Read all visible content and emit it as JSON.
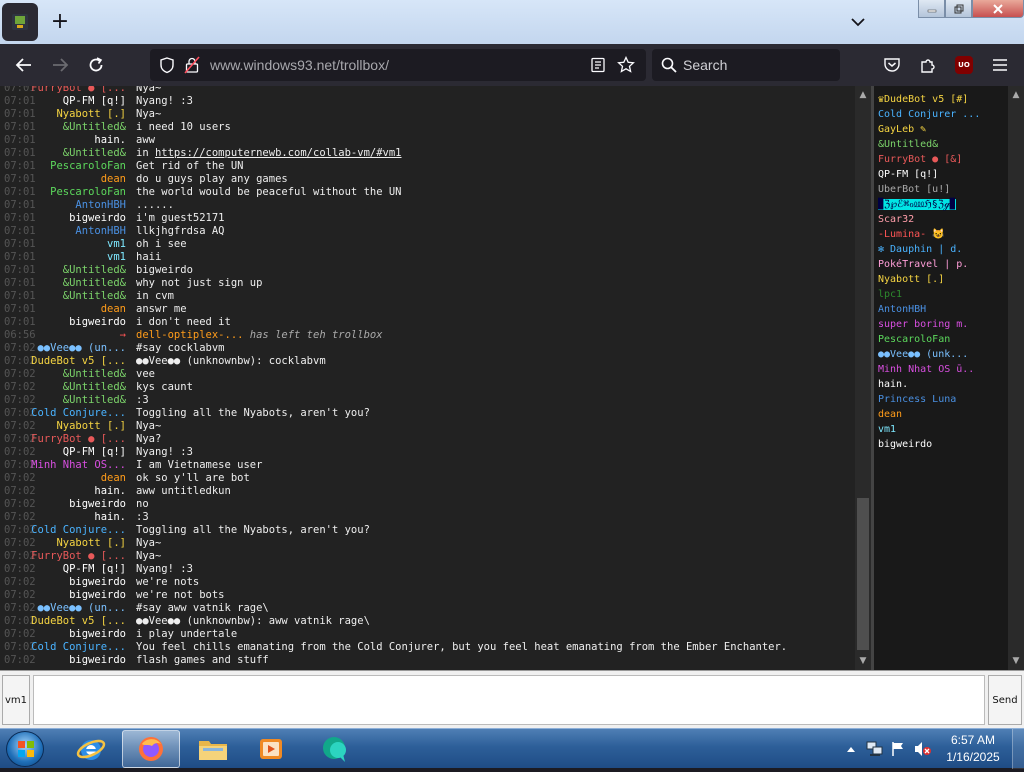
{
  "browser": {
    "url_host": "www.windows93.net",
    "url_path": "/trollbox/",
    "search_placeholder": "Search"
  },
  "trollbox": {
    "messages": [
      {
        "t": "07:01",
        "nick": "FurryBot ● [...",
        "nc": "#e85959",
        "msg": "Nya~"
      },
      {
        "t": "07:01",
        "nick": "QP-FM [q!]",
        "nc": "#ffffff",
        "msg": "Nyang! :3"
      },
      {
        "t": "07:01",
        "nick": "Nyabott [.]",
        "nc": "#f5d442",
        "msg": "Nya~"
      },
      {
        "t": "07:01",
        "nick": "&Untitled&",
        "nc": "#7bd36a",
        "msg": "i need 10 users"
      },
      {
        "t": "07:01",
        "nick": "hain.",
        "nc": "#ffffff",
        "msg": "aww"
      },
      {
        "t": "07:01",
        "nick": "&Untitled&",
        "nc": "#7bd36a",
        "msg": "in ",
        "link": "https://computernewb.com/collab-vm/#vm1"
      },
      {
        "t": "07:01",
        "nick": "PescaroloFan",
        "nc": "#5cd85c",
        "msg": "Get rid of the UN"
      },
      {
        "t": "07:01",
        "nick": "dean",
        "nc": "#ff9c1a",
        "msg": "do u guys play any games"
      },
      {
        "t": "07:01",
        "nick": "PescaroloFan",
        "nc": "#5cd85c",
        "msg": "the world would be peaceful without the UN"
      },
      {
        "t": "07:01",
        "nick": "AntonHBH",
        "nc": "#4a90e2",
        "msg": "......"
      },
      {
        "t": "07:01",
        "nick": "bigweirdo",
        "nc": "#ffffff",
        "msg": "i'm guest52171"
      },
      {
        "t": "07:01",
        "nick": "AntonHBH",
        "nc": "#4a90e2",
        "msg": "llkjhgfrdsa AQ"
      },
      {
        "t": "07:01",
        "nick": "vm1",
        "nc": "#7ee8ff",
        "msg": "oh i see"
      },
      {
        "t": "07:01",
        "nick": "vm1",
        "nc": "#7ee8ff",
        "msg": "haii"
      },
      {
        "t": "07:01",
        "nick": "&Untitled&",
        "nc": "#7bd36a",
        "msg": "bigweirdo"
      },
      {
        "t": "07:01",
        "nick": "&Untitled&",
        "nc": "#7bd36a",
        "msg": "why not just sign up"
      },
      {
        "t": "07:01",
        "nick": "&Untitled&",
        "nc": "#7bd36a",
        "msg": "in cvm"
      },
      {
        "t": "07:01",
        "nick": "dean",
        "nc": "#ff9c1a",
        "msg": "answr me"
      },
      {
        "t": "07:01",
        "nick": "bigweirdo",
        "nc": "#ffffff",
        "msg": "i don't need it"
      },
      {
        "t": "06:56",
        "nick": "→",
        "nc": "#ff5555",
        "sysnick": "dell-optiplex-...",
        "msg": " has left teh trollbox",
        "sys": true
      },
      {
        "t": "07:02",
        "nick": "●●Vee●● (un...",
        "nc": "#7ac0ff",
        "msg": "#say cocklabvm"
      },
      {
        "t": "07:02",
        "nick": "DudeBot v5 [...",
        "nc": "#f5d442",
        "msg": "●●Vee●● (unknownbw): cocklabvm"
      },
      {
        "t": "07:02",
        "nick": "&Untitled&",
        "nc": "#7bd36a",
        "msg": "vee"
      },
      {
        "t": "07:02",
        "nick": "&Untitled&",
        "nc": "#7bd36a",
        "msg": "kys caunt"
      },
      {
        "t": "07:02",
        "nick": "&Untitled&",
        "nc": "#7bd36a",
        "msg": ":3"
      },
      {
        "t": "07:02",
        "nick": "Cold Conjure...",
        "nc": "#4ab3ff",
        "msg": "Toggling all the Nyabots, aren't you?"
      },
      {
        "t": "07:02",
        "nick": "Nyabott [.]",
        "nc": "#f5d442",
        "msg": "Nya~"
      },
      {
        "t": "07:02",
        "nick": "FurryBot ● [...",
        "nc": "#e85959",
        "msg": "Nya?"
      },
      {
        "t": "07:02",
        "nick": "QP-FM [q!]",
        "nc": "#ffffff",
        "msg": "Nyang! :3"
      },
      {
        "t": "07:02",
        "nick": "Minh Nhat OS...",
        "nc": "#d84fe0",
        "msg": "I am Vietnamese user"
      },
      {
        "t": "07:02",
        "nick": "dean",
        "nc": "#ff9c1a",
        "msg": "ok so y'll are bot"
      },
      {
        "t": "07:02",
        "nick": "hain.",
        "nc": "#ffffff",
        "msg": "aww untitledkun"
      },
      {
        "t": "07:02",
        "nick": "bigweirdo",
        "nc": "#ffffff",
        "msg": "no"
      },
      {
        "t": "07:02",
        "nick": "hain.",
        "nc": "#ffffff",
        "msg": ":3"
      },
      {
        "t": "07:02",
        "nick": "Cold Conjure...",
        "nc": "#4ab3ff",
        "msg": "Toggling all the Nyabots, aren't you?"
      },
      {
        "t": "07:02",
        "nick": "Nyabott [.]",
        "nc": "#f5d442",
        "msg": "Nya~"
      },
      {
        "t": "07:02",
        "nick": "FurryBot ● [...",
        "nc": "#e85959",
        "msg": "Nya~"
      },
      {
        "t": "07:02",
        "nick": "QP-FM [q!]",
        "nc": "#ffffff",
        "msg": "Nyang! :3"
      },
      {
        "t": "07:02",
        "nick": "bigweirdo",
        "nc": "#ffffff",
        "msg": "we're nots"
      },
      {
        "t": "07:02",
        "nick": "bigweirdo",
        "nc": "#ffffff",
        "msg": "we're not bots"
      },
      {
        "t": "07:02",
        "nick": "●●Vee●● (un...",
        "nc": "#7ac0ff",
        "msg": "#say aww vatnik rage\\"
      },
      {
        "t": "07:02",
        "nick": "DudeBot v5 [...",
        "nc": "#f5d442",
        "msg": "●●Vee●● (unknownbw): aww vatnik rage\\"
      },
      {
        "t": "07:02",
        "nick": "bigweirdo",
        "nc": "#ffffff",
        "msg": "i play undertale"
      },
      {
        "t": "07:02",
        "nick": "Cold Conjure...",
        "nc": "#4ab3ff",
        "msg": "You feel chills emanating from the Cold Conjurer, but you feel heat emanating from the Ember Enchanter."
      },
      {
        "t": "07:02",
        "nick": "bigweirdo",
        "nc": "#ffffff",
        "msg": "flash games and stuff"
      }
    ],
    "users": [
      {
        "name": "♛DudeBot v5 [#]",
        "c": "#f5d442"
      },
      {
        "name": "Cold Conjurer ...",
        "c": "#4ab3ff"
      },
      {
        "name": "GayLeb ✎",
        "c": "#f5d442"
      },
      {
        "name": "&Untitled&",
        "c": "#7bd36a"
      },
      {
        "name": "FurryBot ● [&]",
        "c": "#e85959"
      },
      {
        "name": "QP-FM [q!]",
        "c": "#ffffff"
      },
      {
        "name": "UberBot [u!]",
        "c": "#aaaaaa"
      },
      {
        "name": "▉ℨ℘ℰ⌘ℴ⅏ℌ§ℨℊ▉",
        "c": "#00e5e5",
        "highlight": true
      },
      {
        "name": "Scar32",
        "c": "#ff9eaa"
      },
      {
        "name": "-Lumina- 😺",
        "c": "#ff5555"
      },
      {
        "name": "✻ Dauphin | d.",
        "c": "#4ab3ff"
      },
      {
        "name": "PokéTravel | p.",
        "c": "#ff9ed8"
      },
      {
        "name": "Nyabott [.]",
        "c": "#f5d442"
      },
      {
        "name": "lpc1",
        "c": "#2d8a2d"
      },
      {
        "name": "AntonHBH",
        "c": "#4a90e2"
      },
      {
        "name": "super boring m.",
        "c": "#d84fe0"
      },
      {
        "name": "PescaroloFan",
        "c": "#5cd85c"
      },
      {
        "name": "●●Vee●● (unk...",
        "c": "#7ac0ff"
      },
      {
        "name": "Minh Nhat OS ū..",
        "c": "#d84fe0"
      },
      {
        "name": "hain.",
        "c": "#ffffff"
      },
      {
        "name": "Princess Luna",
        "c": "#4a90e2"
      },
      {
        "name": "dean",
        "c": "#ff9c1a"
      },
      {
        "name": "vm1",
        "c": "#7ee8ff"
      },
      {
        "name": "bigweirdo",
        "c": "#ffffff"
      }
    ],
    "nickname_button": "vm1",
    "send_button": "Send",
    "input_value": ""
  },
  "taskbar": {
    "time": "6:57 AM",
    "date": "1/16/2025",
    "apps": [
      "internet-explorer-icon",
      "firefox-icon",
      "file-explorer-icon",
      "media-player-icon",
      "chat-app-icon"
    ]
  }
}
